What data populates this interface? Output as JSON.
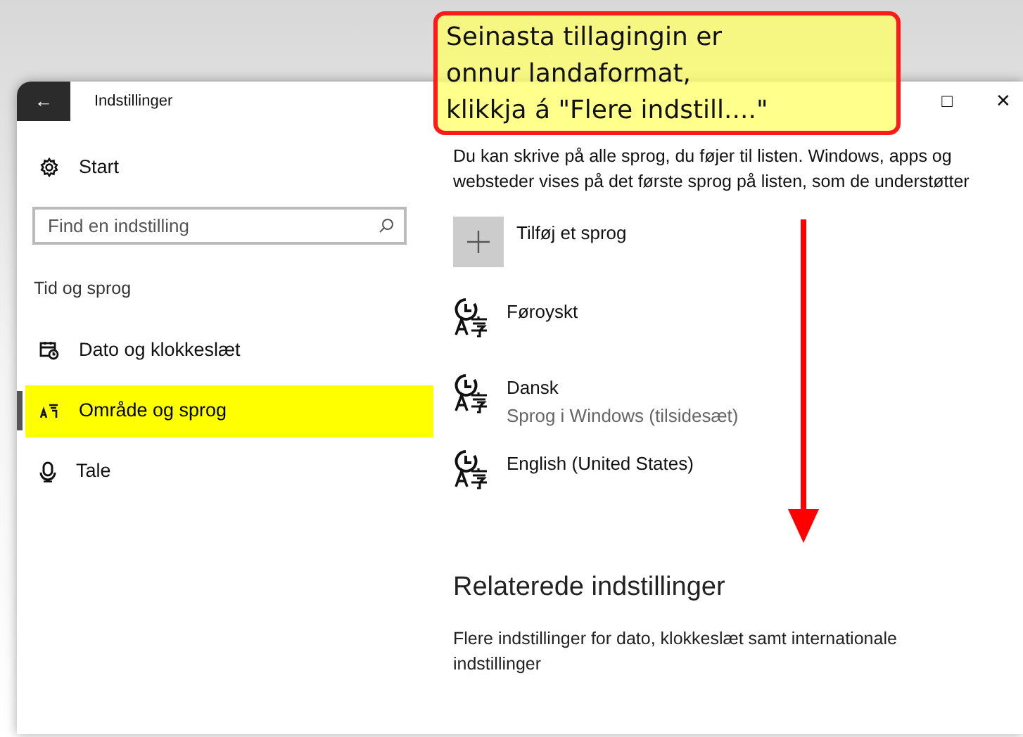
{
  "window": {
    "title": "Indstillinger",
    "back": "←",
    "maximize": "□",
    "close": "✕"
  },
  "sidebar": {
    "home": "Start",
    "search": {
      "placeholder": "Find en indstilling"
    },
    "section": "Tid og sprog",
    "items": [
      {
        "label": "Dato og klokkeslæt",
        "selected": false
      },
      {
        "label": "Område og sprog",
        "selected": true
      },
      {
        "label": "Tale",
        "selected": false
      }
    ]
  },
  "content": {
    "description": "Du kan skrive på alle sprog, du føjer til listen. Windows, apps og websteder vises på det første sprog på listen, som de understøtter",
    "add_language": "Tilføj et sprog",
    "languages": [
      {
        "name": "Føroyskt"
      },
      {
        "name": "Dansk",
        "detail": "Sprog i Windows (tilsidesæt)"
      },
      {
        "name": "English (United States)"
      }
    ],
    "related_heading": "Relaterede indstillinger",
    "related_link": "Flere indstillinger for dato, klokkeslæt samt internationale indstillinger"
  },
  "callout": {
    "text": "Seinasta tillagingin er\nonnur landaformat,\nklikkja á \"Flere indstill....\""
  }
}
